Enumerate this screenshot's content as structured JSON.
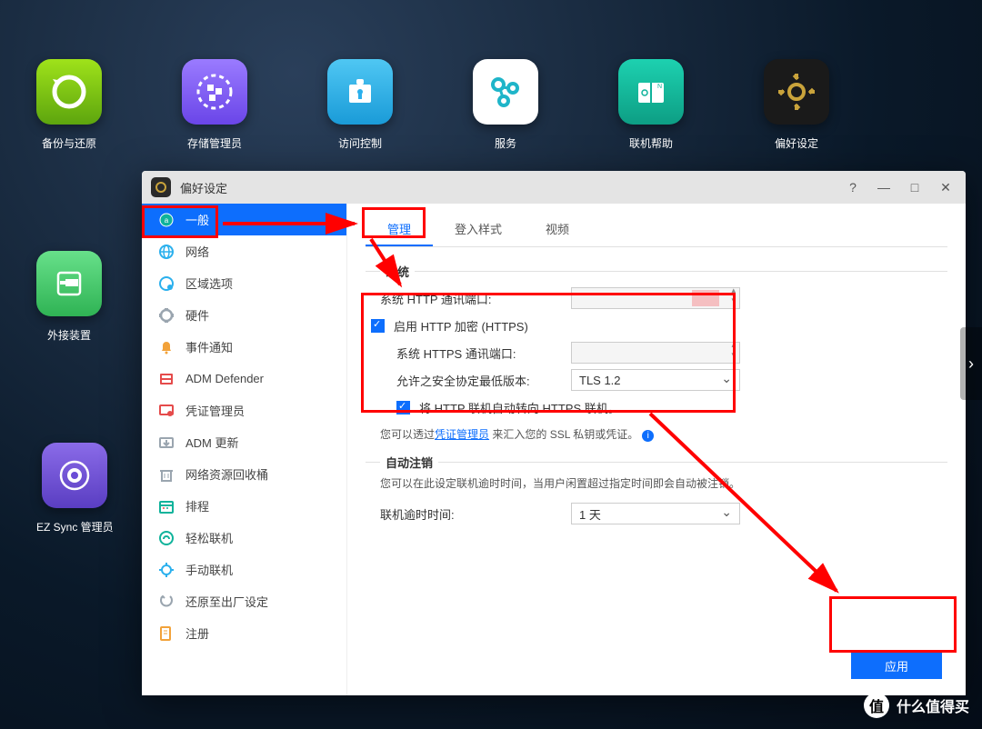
{
  "desktop": {
    "row1": [
      {
        "label": "备份与还原",
        "color": "#7cb518",
        "icon": "backup"
      },
      {
        "label": "存储管理员",
        "color": "#7b5cff",
        "icon": "storage"
      },
      {
        "label": "访问控制",
        "color": "#2bb0ed",
        "icon": "access"
      },
      {
        "label": "服务",
        "color": "#ffffff",
        "icon": "services"
      },
      {
        "label": "联机帮助",
        "color": "#0fb39b",
        "icon": "help"
      },
      {
        "label": "偏好设定",
        "color": "#1a1a1a",
        "icon": "gear"
      }
    ],
    "row2": [
      {
        "label": "外接装置",
        "color": "#4fc96a",
        "icon": "external"
      }
    ],
    "row3": [
      {
        "label": "EZ Sync 管理员",
        "color": "#6b4dd6",
        "icon": "sync"
      }
    ]
  },
  "window": {
    "title": "偏好设定",
    "sidebar": [
      {
        "label": "一般",
        "icon": "general",
        "active": true,
        "color": "#0fb39b"
      },
      {
        "label": "网络",
        "icon": "network",
        "color": "#2bb0ed"
      },
      {
        "label": "区域选项",
        "icon": "region",
        "color": "#2bb0ed"
      },
      {
        "label": "硬件",
        "icon": "hardware",
        "color": "#9aa5af"
      },
      {
        "label": "事件通知",
        "icon": "notify",
        "color": "#f2a23a"
      },
      {
        "label": "ADM Defender",
        "icon": "defender",
        "color": "#e54b4b"
      },
      {
        "label": "凭证管理员",
        "icon": "cert",
        "color": "#e54b4b"
      },
      {
        "label": "ADM 更新",
        "icon": "update",
        "color": "#9aa5af"
      },
      {
        "label": "网络资源回收桶",
        "icon": "recycle",
        "color": "#9aa5af"
      },
      {
        "label": "排程",
        "icon": "schedule",
        "color": "#0fb39b"
      },
      {
        "label": "轻松联机",
        "icon": "ezconnect",
        "color": "#0fb39b"
      },
      {
        "label": "手动联机",
        "icon": "manual",
        "color": "#2bb0ed"
      },
      {
        "label": "还原至出厂设定",
        "icon": "factory",
        "color": "#9aa5af"
      },
      {
        "label": "注册",
        "icon": "register",
        "color": "#f2a23a"
      }
    ],
    "tabs": [
      {
        "label": "管理",
        "active": true
      },
      {
        "label": "登入样式"
      },
      {
        "label": "视频"
      }
    ],
    "section_system": "系统",
    "http_port_label": "系统 HTTP 通讯端口:",
    "enable_https_label": "启用 HTTP 加密 (HTTPS)",
    "https_port_label": "系统 HTTPS 通讯端口:",
    "tls_label": "允许之安全协定最低版本:",
    "tls_value": "TLS 1.2",
    "redirect_label": "将 HTTP 联机自动转向 HTTPS 联机。",
    "ssl_hint_pre": "您可以透过",
    "ssl_hint_link": "凭证管理员",
    "ssl_hint_post": " 来汇入您的 SSL 私钥或凭证。",
    "section_logout": "自动注销",
    "logout_hint": "您可以在此设定联机逾时时间，当用户闲置超过指定时间即会自动被注销。",
    "logout_time_label": "联机逾时时间:",
    "logout_time_value": "1 天",
    "apply": "应用"
  },
  "watermark": "什么值得买"
}
